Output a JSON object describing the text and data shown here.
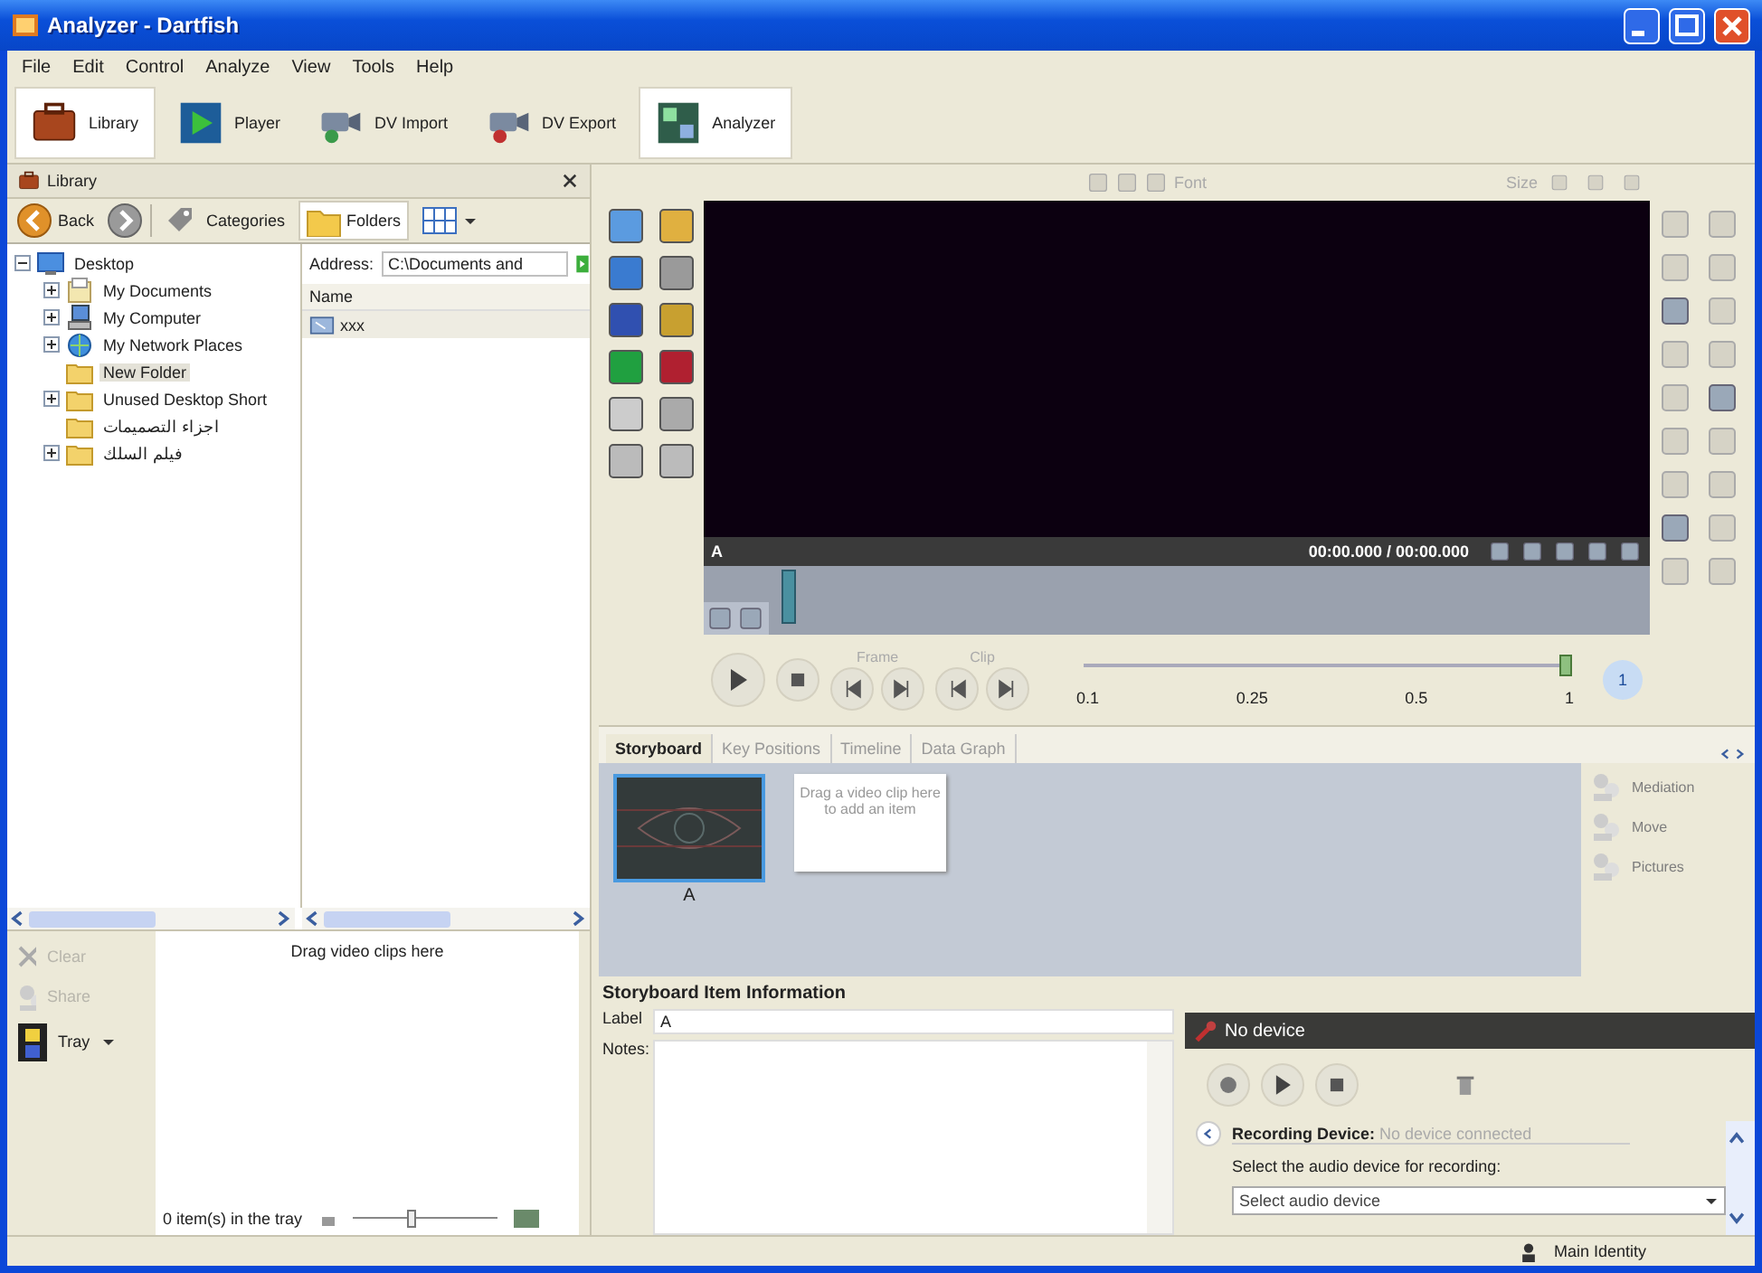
{
  "window": {
    "title": "Analyzer - Dartfish"
  },
  "menu": [
    "File",
    "Edit",
    "Control",
    "Analyze",
    "View",
    "Tools",
    "Help"
  ],
  "modes": [
    {
      "label": "Library",
      "selected": true
    },
    {
      "label": "Player",
      "selected": false
    },
    {
      "label": "DV Import",
      "selected": false
    },
    {
      "label": "DV Export",
      "selected": false
    },
    {
      "label": "Analyzer",
      "selected": true
    }
  ],
  "library": {
    "title": "Library",
    "back": "Back",
    "views": [
      {
        "label": "Categories",
        "selected": false
      },
      {
        "label": "Folders",
        "selected": true
      }
    ]
  },
  "tree": [
    {
      "label": "Desktop",
      "kind": "desktop",
      "expanded": true,
      "selected": false,
      "children": [
        {
          "label": "My Documents",
          "kind": "documents",
          "expanded": false,
          "selected": false
        },
        {
          "label": "My Computer",
          "kind": "computer",
          "expanded": false,
          "selected": false
        },
        {
          "label": "My Network Places",
          "kind": "network",
          "expanded": false,
          "selected": false
        },
        {
          "label": "New Folder",
          "kind": "folder",
          "selected": true
        },
        {
          "label": "Unused Desktop Short",
          "kind": "folder",
          "expanded": false,
          "selected": false
        },
        {
          "label": "اجزاء التصميمات",
          "kind": "folder",
          "selected": false
        },
        {
          "label": "فيلم السلك",
          "kind": "folder",
          "expanded": false,
          "selected": false
        }
      ]
    }
  ],
  "address": {
    "label": "Address:",
    "value": "C:\\Documents and"
  },
  "files": {
    "column": "Name",
    "rows": [
      "xxx"
    ]
  },
  "tray": {
    "actions": [
      {
        "label": "Clear",
        "disabled": true
      },
      {
        "label": "Share",
        "disabled": true
      },
      {
        "label": "Tray",
        "disabled": false
      }
    ],
    "hint": "Drag video clips here",
    "count": "0 item(s) in the tray",
    "zoom": {
      "level": 0.4
    }
  },
  "viewer": {
    "toolbar": {
      "font": "Font",
      "size": "Size"
    },
    "clip_label": "A",
    "time": "00:00.000 / 00:00.000",
    "playhead": {
      "level": 0.09
    }
  },
  "controls": {
    "frame": "Frame",
    "clip": "Clip",
    "speed": {
      "level": 1,
      "ticks": [
        "0.1",
        "0.25",
        "0.5",
        "1"
      ]
    },
    "speed_button": "1"
  },
  "tabs": [
    {
      "label": "Storyboard",
      "selected": true
    },
    {
      "label": "Key Positions",
      "selected": false
    },
    {
      "label": "Timeline",
      "selected": false
    },
    {
      "label": "Data Graph",
      "selected": false
    }
  ],
  "storyboard": {
    "items": [
      {
        "label": "A",
        "selected": true
      }
    ],
    "drop_hint": "Drag a video clip here to add an item",
    "actions": [
      {
        "label": "Mediation",
        "disabled": true
      },
      {
        "label": "Move",
        "disabled": true
      },
      {
        "label": "Pictures",
        "disabled": true
      }
    ]
  },
  "item_info": {
    "title": "Storyboard Item Information",
    "label_caption": "Label",
    "label_value": "A",
    "notes_caption": "Notes:"
  },
  "recorder": {
    "title": "No device",
    "device_caption": "Recording Device:",
    "device_status": "No device connected",
    "instruction": "Select the audio device for recording:",
    "device_select": "Select audio device"
  },
  "status_bar": {
    "identity": "Main Identity"
  }
}
